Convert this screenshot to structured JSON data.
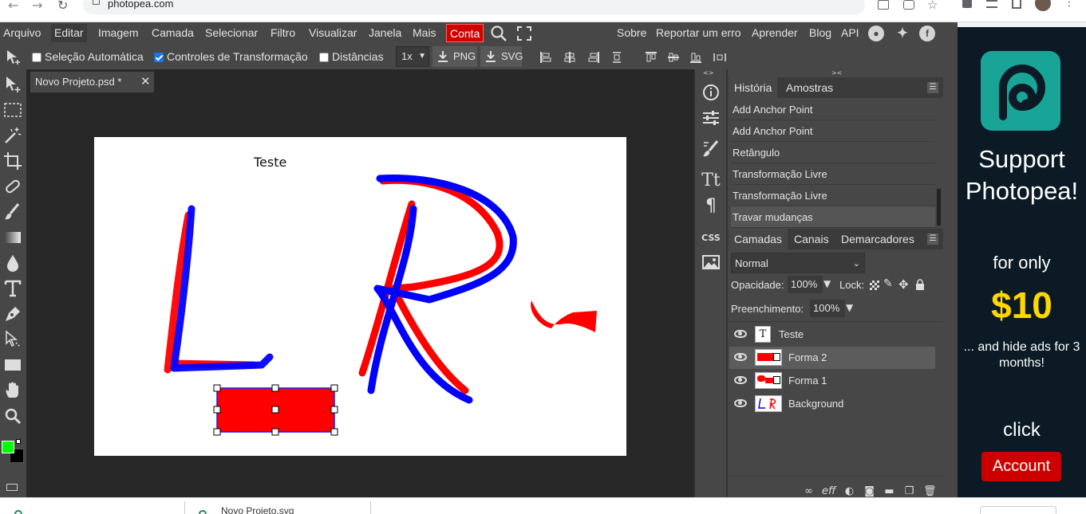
{
  "browser": {
    "url": "photopea.com"
  },
  "menu": {
    "items": [
      "Arquivo",
      "Editar",
      "Imagem",
      "Camada",
      "Selecionar",
      "Filtro",
      "Visualizar",
      "Janela",
      "Mais"
    ],
    "account_label": "Conta",
    "right_links": [
      "Sobre",
      "Reportar um erro",
      "Aprender",
      "Blog",
      "API"
    ]
  },
  "options": {
    "auto_select_label": "Seleção Automática",
    "auto_select_checked": false,
    "transform_label": "Controles de Transformação",
    "transform_checked": true,
    "distances_label": "Distâncias",
    "distances_checked": false,
    "zoom_value": "1x",
    "png_label": "PNG",
    "svg_label": "SVG"
  },
  "document": {
    "tab_title": "Novo Projeto.psd *",
    "canvas_text": "Teste"
  },
  "history": {
    "tabs": [
      "História",
      "Amostras"
    ],
    "items": [
      "Add Anchor Point",
      "Add Anchor Point",
      "Retângulo",
      "Transformação Livre",
      "Transformação Livre",
      "Travar mudanças"
    ]
  },
  "layers": {
    "tabs": [
      "Camadas",
      "Canais",
      "Demarcadores"
    ],
    "blend_mode": "Normal",
    "opacity_label": "Opacidade:",
    "opacity_value": "100%",
    "lock_label": "Lock:",
    "fill_label": "Preenchimento:",
    "fill_value": "100%",
    "items": [
      {
        "name": "Teste",
        "thumb": "T"
      },
      {
        "name": "Forma 2"
      },
      {
        "name": "Forma 1"
      },
      {
        "name": "Background"
      }
    ],
    "selected_index": 1
  },
  "ad": {
    "support": "Support Photopea!",
    "for_only": "for only",
    "price": "$10",
    "hide_ads": "... and hide ads for 3 months!",
    "click": "click",
    "account_button": "Account"
  },
  "downloads": {
    "file": "Novo Projeto.svg"
  },
  "colors": {
    "app_bg": "#474747",
    "workspace_bg": "#282828",
    "accent_red": "#d10000",
    "ad_bg": "#0b1a24",
    "ad_price": "#ffd700",
    "ad_logo": "#18a497",
    "foreground_color": "#00ff00",
    "background_color": "#000000"
  }
}
